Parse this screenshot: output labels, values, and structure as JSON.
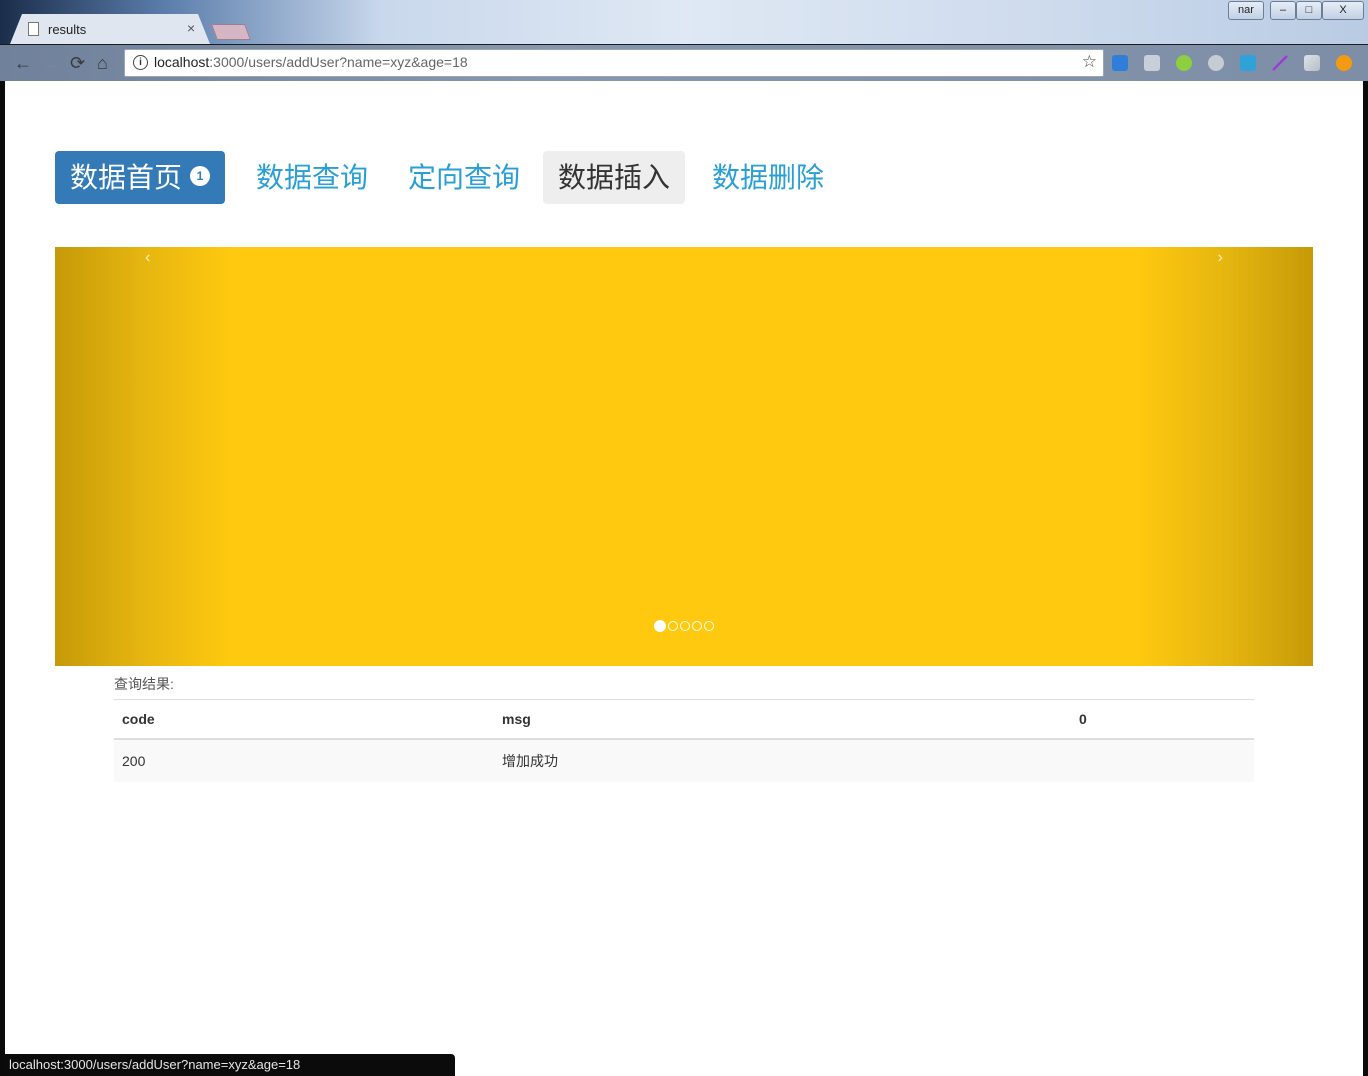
{
  "browser": {
    "tab_title": "results",
    "tab_close": "×",
    "window_user": "nar",
    "window_min": "–",
    "window_max": "□",
    "window_close": "X",
    "back": "←",
    "forward": "→",
    "reload": "⟳",
    "home": "⌂",
    "info": "i",
    "url_host": "localhost",
    "url_rest": ":3000/users/addUser?name=xyz&age=18",
    "bookmark_star": "☆",
    "status_url": "localhost:3000/users/addUser?name=xyz&age=18"
  },
  "nav": {
    "items": [
      {
        "label": "数据首页",
        "badge": "1"
      },
      {
        "label": "数据查询"
      },
      {
        "label": "定向查询"
      },
      {
        "label": "数据插入"
      },
      {
        "label": "数据删除"
      }
    ]
  },
  "carousel": {
    "prev": "‹",
    "next": "›",
    "slide_count": 5,
    "active_index": 0,
    "color": "#ffc90f"
  },
  "results": {
    "label": "查询结果:",
    "headers": [
      "code",
      "msg",
      "0"
    ],
    "rows": [
      [
        "200",
        "增加成功",
        ""
      ]
    ]
  },
  "colors": {
    "accent": "#337ab7",
    "link": "#2a9fd6"
  }
}
